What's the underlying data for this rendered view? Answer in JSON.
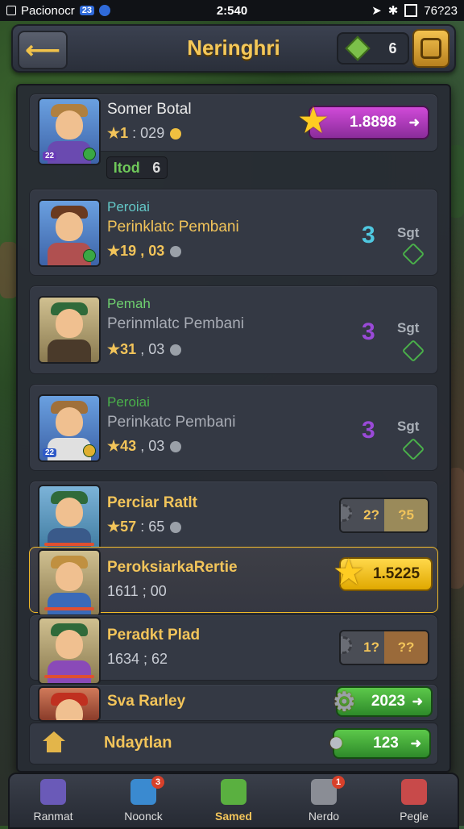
{
  "status_bar": {
    "carrier": "Pacionocr",
    "badge": "23",
    "time": "2:540",
    "battery": "76?23"
  },
  "header": {
    "back_glyph": "⟵",
    "title": "Neringhri",
    "currency_value": "6"
  },
  "colors": {
    "accent_gold": "#f2c45a",
    "panel": "#343944",
    "magenta": "#d04ad8",
    "green": "#5cc84a"
  },
  "featured": {
    "name": "Somer Botal",
    "stat_star": "1",
    "stat_value": ": 029",
    "avatar_badge": "22",
    "level_label": "Itod",
    "level_value": "6",
    "pill_value": "1.8898",
    "pill_arrow": "➜"
  },
  "entries": [
    {
      "name": "Peroiai",
      "subtitle": "Perinklatc Pembani",
      "stat_star": "19",
      "stat_value": ", 03",
      "rank": "3",
      "tag": "Sgt"
    },
    {
      "name": "Pemah",
      "subtitle": "Perinmlatc Pembani",
      "stat_star": "31",
      "stat_value": ", 03",
      "rank": "3",
      "tag": "Sgt"
    },
    {
      "name": "Peroiai",
      "subtitle": "Perinkatc Pembani",
      "stat_star": "43",
      "stat_value": ", 03",
      "rank": "3",
      "tag": "Sgt",
      "avatar_badge": "22"
    }
  ],
  "rewards": [
    {
      "name": "Perciar Ratlt",
      "stat_star": "57",
      "stat_value": ": 65",
      "left_value": "2?",
      "right_value": "?5"
    },
    {
      "name": "PeroksiarkaRertie",
      "stat": "1611 ; 00",
      "pill_value": "1.5225"
    },
    {
      "name": "Peradkt Plad",
      "stat": "1634 ; 62",
      "left_value": "1?",
      "right_value": "??"
    },
    {
      "name": "Sva Rarley",
      "pill_value": "2023",
      "pill_arrow": "➜"
    }
  ],
  "footer_row": {
    "label": "Ndaytlan",
    "pill_value": "123",
    "pill_arrow": "➜"
  },
  "nav": [
    {
      "label": "Ranmat",
      "notif": ""
    },
    {
      "label": "Noonck",
      "notif": "3"
    },
    {
      "label": "Samed",
      "notif": ""
    },
    {
      "label": "Nerdo",
      "notif": "1"
    },
    {
      "label": "Pegle",
      "notif": ""
    }
  ]
}
